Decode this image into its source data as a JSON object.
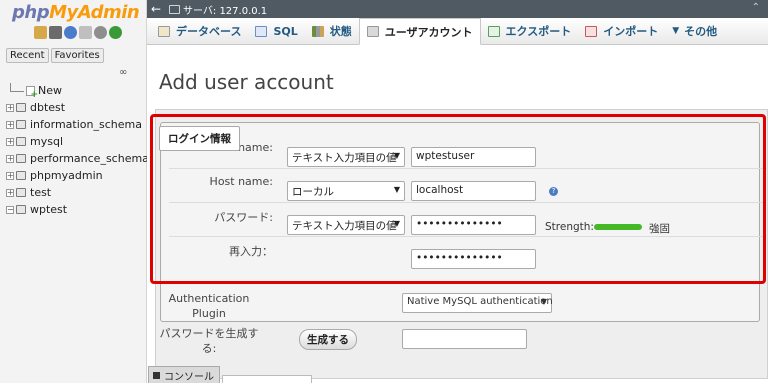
{
  "app": {
    "logo_php": "php",
    "logo_admin": "MyAdmin"
  },
  "sidebar": {
    "recent_label": "Recent",
    "favorites_label": "Favorites",
    "link_icon": "chain-link-icon",
    "tree": [
      {
        "label": "New",
        "type": "new"
      },
      {
        "label": "dbtest",
        "type": "db"
      },
      {
        "label": "information_schema",
        "type": "db"
      },
      {
        "label": "mysql",
        "type": "db"
      },
      {
        "label": "performance_schema",
        "type": "db"
      },
      {
        "label": "phpmyadmin",
        "type": "db"
      },
      {
        "label": "test",
        "type": "db"
      },
      {
        "label": "wptest",
        "type": "db-open"
      }
    ]
  },
  "serverbar": {
    "breadcrumb": "サーバ: 127.0.0.1"
  },
  "tabs": [
    {
      "label": "データベース",
      "icon": "database-icon",
      "icon_color": "#c9a35a",
      "active": false
    },
    {
      "label": "SQL",
      "icon": "sql-icon",
      "icon_color": "#6b8fc7",
      "active": false
    },
    {
      "label": "状態",
      "icon": "status-icon",
      "icon_color": "#6a8f3c",
      "active": false
    },
    {
      "label": "ユーザアカウント",
      "icon": "users-icon",
      "icon_color": "#7a7a7a",
      "active": true
    },
    {
      "label": "エクスポート",
      "icon": "export-icon",
      "icon_color": "#5aa05a",
      "active": false
    },
    {
      "label": "インポート",
      "icon": "import-icon",
      "icon_color": "#c65a5a",
      "active": false
    },
    {
      "label": "その他",
      "icon": "more-arrow-icon",
      "icon_color": "#333333",
      "active": false
    }
  ],
  "page": {
    "title": "Add user account"
  },
  "login": {
    "legend": "ログイン情報",
    "user_name_label": "User name:",
    "user_name_select": "テキスト入力項目の値",
    "user_name_value": "wptestuser",
    "host_name_label": "Host name:",
    "host_name_select": "ローカル",
    "host_name_value": "localhost",
    "password_label": "パスワード:",
    "password_select": "テキスト入力項目の値",
    "password_value": "••••••••••••••",
    "strength_label": "Strength:",
    "strength_fraction": 1.0,
    "strength_text": "強固",
    "retype_label": "再入力：",
    "retype_value": "••••••••••••••"
  },
  "auth": {
    "label": "Authentication Plugin",
    "value": "Native MySQL authentication"
  },
  "generate": {
    "label": "パスワードを生成する:",
    "button": "生成する",
    "value": ""
  },
  "console": {
    "label": "コンソール"
  },
  "colors": {
    "highlight": "#e00000",
    "strength": "#45b828",
    "serverbar": "#4f5a63"
  }
}
